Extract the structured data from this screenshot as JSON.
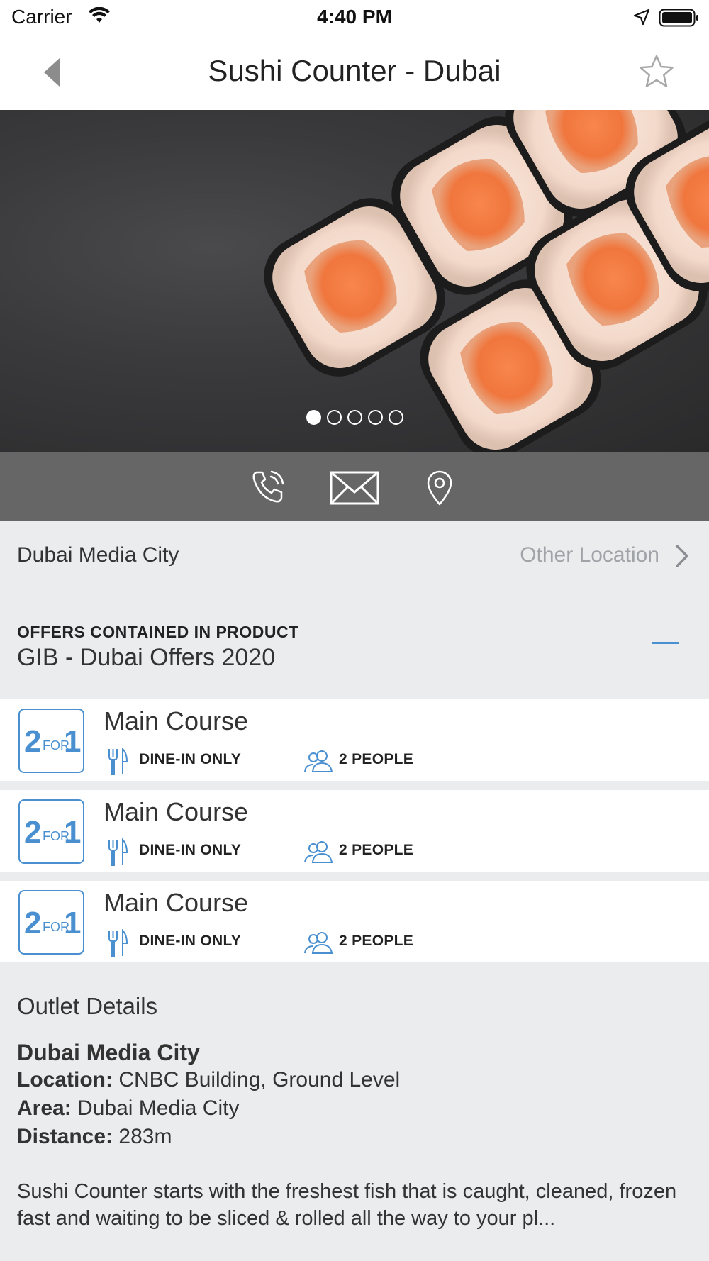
{
  "status_bar": {
    "carrier": "Carrier",
    "time": "4:40 PM"
  },
  "nav": {
    "title": "Sushi Counter - Dubai",
    "icons": [
      "back-icon",
      "star-icon"
    ]
  },
  "gallery": {
    "page_count": 5,
    "active_index": 0
  },
  "contact_icons": [
    "phone-icon",
    "mail-icon",
    "map-pin-icon"
  ],
  "location": {
    "name": "Dubai Media City",
    "other_label": "Other Location"
  },
  "offers": {
    "section_label": "OFFERS CONTAINED IN PRODUCT",
    "product_name": "GIB - Dubai Offers 2020",
    "items": [
      {
        "badge_two": "2",
        "badge_for": "FOR",
        "badge_one": "1",
        "title": "Main Course",
        "restriction": "DINE-IN ONLY",
        "people": "2 PEOPLE"
      },
      {
        "badge_two": "2",
        "badge_for": "FOR",
        "badge_one": "1",
        "title": "Main Course",
        "restriction": "DINE-IN ONLY",
        "people": "2 PEOPLE"
      },
      {
        "badge_two": "2",
        "badge_for": "FOR",
        "badge_one": "1",
        "title": "Main Course",
        "restriction": "DINE-IN ONLY",
        "people": "2 PEOPLE"
      }
    ]
  },
  "outlet": {
    "heading": "Outlet Details",
    "branch": "Dubai Media City",
    "location_label": "Location:",
    "location_value": "CNBC Building, Ground Level",
    "area_label": "Area:",
    "area_value": "Dubai Media City",
    "distance_label": "Distance:",
    "distance_value": "283m",
    "description": "Sushi Counter starts with the freshest fish that is caught, cleaned, frozen fast and waiting to be sliced & rolled all the way to your pl..."
  },
  "colors": {
    "accent": "#4a90d0",
    "contact_bar": "#666667",
    "background": "#ebecee"
  }
}
